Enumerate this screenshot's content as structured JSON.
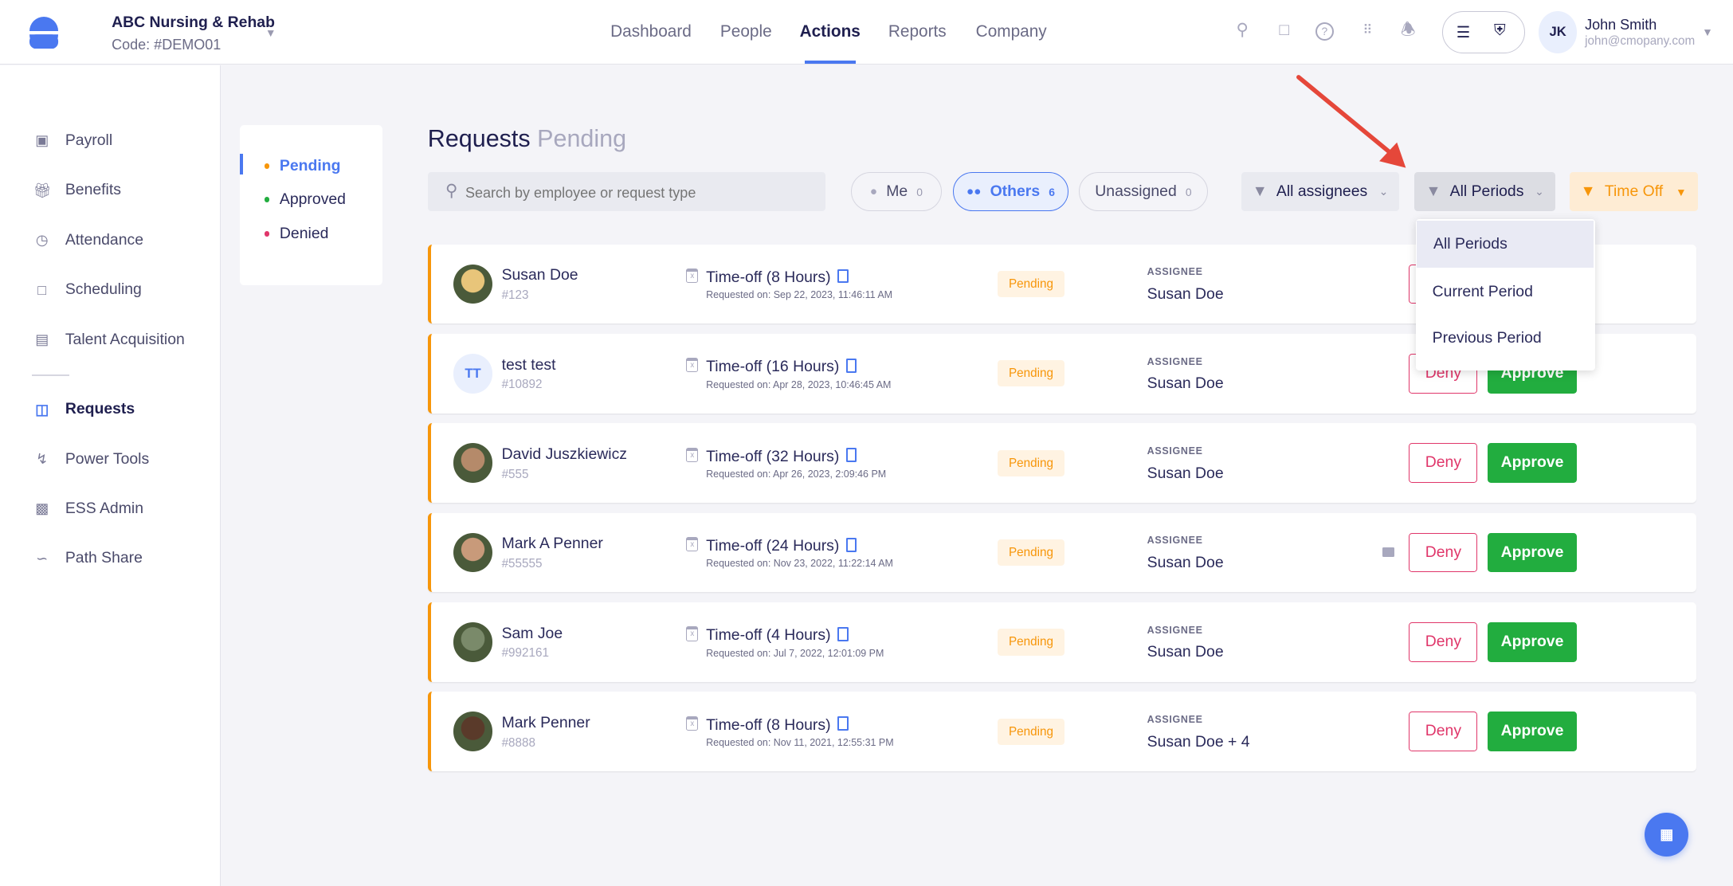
{
  "header": {
    "company": "ABC Nursing & Rehab",
    "code": "Code: #DEMO01",
    "nav": [
      {
        "label": "Dashboard"
      },
      {
        "label": "People"
      },
      {
        "label": "Actions",
        "active": true
      },
      {
        "label": "Reports"
      },
      {
        "label": "Company"
      }
    ],
    "user": {
      "initials": "JK",
      "name": "John Smith",
      "email": "john@cmopany.com"
    }
  },
  "sidebar": {
    "items": [
      {
        "label": "Payroll",
        "icon": "payroll-icon"
      },
      {
        "label": "Benefits",
        "icon": "gift-icon"
      },
      {
        "label": "Attendance",
        "icon": "clock-icon"
      },
      {
        "label": "Scheduling",
        "icon": "calendar-icon"
      },
      {
        "label": "Talent Acquisition",
        "icon": "talent-icon"
      },
      {
        "label": "Requests",
        "icon": "requests-icon",
        "active": true
      },
      {
        "label": "Power Tools",
        "icon": "bolt-icon"
      },
      {
        "label": "ESS Admin",
        "icon": "badge-icon"
      },
      {
        "label": "Path Share",
        "icon": "path-icon"
      }
    ]
  },
  "status_filter": {
    "items": [
      {
        "label": "Pending",
        "color": "#f7960a",
        "active": true
      },
      {
        "label": "Approved",
        "color": "#22ad3f"
      },
      {
        "label": "Denied",
        "color": "#e0366a"
      }
    ]
  },
  "page": {
    "title": "Requests",
    "subtitle": "Pending"
  },
  "search": {
    "placeholder": "Search by employee or request type",
    "value": ""
  },
  "tabs": [
    {
      "label": "Me",
      "count": "0"
    },
    {
      "label": "Others",
      "count": "6",
      "active": true
    },
    {
      "label": "Unassigned",
      "count": "0"
    }
  ],
  "filters": {
    "assignees": "All assignees",
    "periods": "All Periods",
    "type": "Time Off"
  },
  "period_dropdown": {
    "options": [
      "All Periods",
      "Current Period",
      "Previous Period"
    ],
    "selected": "All Periods"
  },
  "requests": [
    {
      "name": "Susan Doe",
      "id": "#123",
      "type": "Time-off (8 Hours)",
      "requested": "Requested on: Sep 22, 2023, 11:46:11 AM",
      "status": "Pending",
      "assignee_label": "ASSIGNEE",
      "assignee": "Susan Doe",
      "avatar": "photo"
    },
    {
      "name": "test test",
      "id": "#10892",
      "type": "Time-off (16 Hours)",
      "requested": "Requested on: Apr 28, 2023, 10:46:45 AM",
      "status": "Pending",
      "assignee_label": "ASSIGNEE",
      "assignee": "Susan Doe",
      "avatar": "TT"
    },
    {
      "name": "David Juszkiewicz",
      "id": "#555",
      "type": "Time-off (32 Hours)",
      "requested": "Requested on: Apr 26, 2023, 2:09:46 PM",
      "status": "Pending",
      "assignee_label": "ASSIGNEE",
      "assignee": "Susan Doe",
      "avatar": "photo"
    },
    {
      "name": "Mark A Penner",
      "id": "#55555",
      "type": "Time-off (24 Hours)",
      "requested": "Requested on: Nov 23, 2022, 11:22:14 AM",
      "status": "Pending",
      "assignee_label": "ASSIGNEE",
      "assignee": "Susan Doe",
      "avatar": "photo",
      "comment": true
    },
    {
      "name": "Sam Joe",
      "id": "#992161",
      "type": "Time-off (4 Hours)",
      "requested": "Requested on: Jul 7, 2022, 12:01:09 PM",
      "status": "Pending",
      "assignee_label": "ASSIGNEE",
      "assignee": "Susan Doe",
      "avatar": "photo"
    },
    {
      "name": "Mark Penner",
      "id": "#8888",
      "type": "Time-off (8 Hours)",
      "requested": "Requested on: Nov 11, 2021, 12:55:31 PM",
      "status": "Pending",
      "assignee_label": "ASSIGNEE",
      "assignee": "Susan Doe + 4",
      "avatar": "photo"
    }
  ],
  "actions": {
    "deny": "Deny",
    "approve": "Approve"
  },
  "colors": {
    "accent": "#4a78f0",
    "pending": "#f7960a",
    "approve": "#22ad3f",
    "deny": "#e0366a"
  }
}
